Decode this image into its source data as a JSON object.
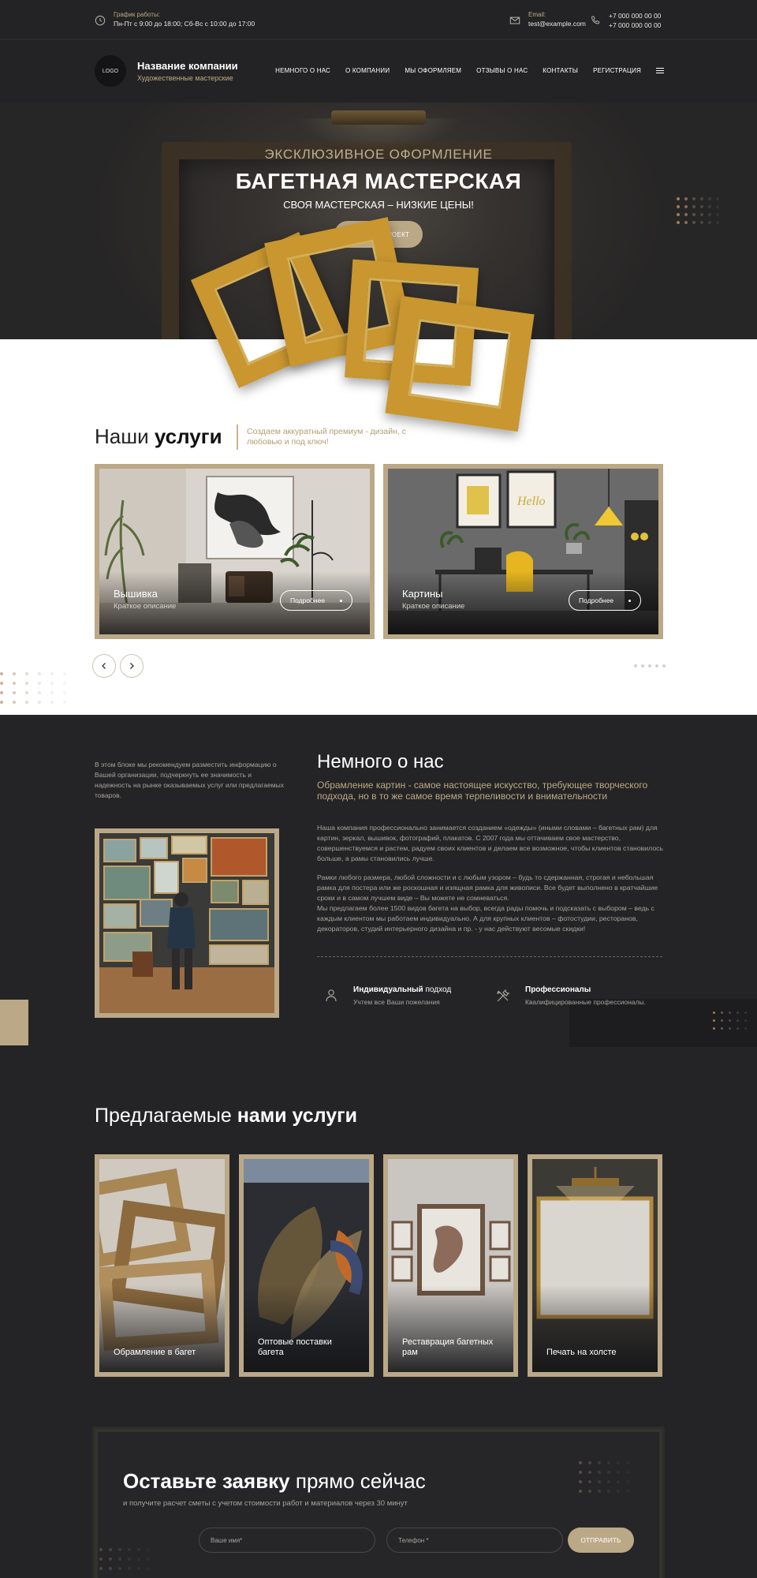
{
  "topbar": {
    "schedule_label": "График работы:",
    "schedule_value": "Пн-Пт с 9:00 до 18:00; Сб-Вс с 10:00 до 17:00",
    "email_label": "Email:",
    "email_value": "test@example.com",
    "phone_1": "+7 000 000 00 00",
    "phone_2": "+7 000 000 00 00",
    "icons": [
      "clock-icon",
      "mail-icon",
      "phone-icon"
    ]
  },
  "header": {
    "logo": "LOGO",
    "company_name": "Название компании",
    "company_tagline": "Художественные мастерские",
    "nav": [
      "НЕМНОГО О НАС",
      "О КОМПАНИИ",
      "МЫ ОФОРМЛЯЕМ",
      "ОТЗЫВЫ О НАС",
      "КОНТАКТЫ",
      "РЕГИСТРАЦИЯ"
    ],
    "menu_icon": "burger-menu-icon"
  },
  "hero": {
    "eyebrow": "ЭКСКЛЮЗИВНОЕ ОФОРМЛЕНИЕ",
    "title": "БАГЕТНАЯ МАСТЕРСКАЯ",
    "subtitle": "СВОЯ МАСТЕРСКАЯ – НИЗКИЕ ЦЕНЫ!",
    "button": "ЗАКАЗАТЬ ПРОЕКТ"
  },
  "services": {
    "heading_light": "Наши",
    "heading_bold": "услуги",
    "note": "Создаем аккуратный премиум - дизайн, с любовью и под ключ!",
    "cards": [
      {
        "title": "Вышивка",
        "desc": "Краткое описание",
        "button": "Подробнее"
      },
      {
        "title": "Картины",
        "desc": "Краткое описание",
        "button": "Подробнее"
      }
    ],
    "prev_icon": "chevron-left-icon",
    "next_icon": "chevron-right-icon",
    "pages": 5
  },
  "about": {
    "side_text": "В этом блоке мы рекомендуем разместить информацию о Вашей организации, подчеркнуть ее значимость и надежность на рынке оказываемых услуг или предлагаемых товаров.",
    "title": "Немного о нас",
    "subtitle": "Обрамление картин - самое настоящее искусство, требующее творческого подхода, но в то же самое время терпеливости и внимательности",
    "p1": "Наша компания профессионально занимается созданием «одежды» (иными словами – багетных рам) для картин, зеркал, вышивок, фотографий, плакатов. С 2007 года мы оттачиваем свое мастерство, совершенствуемся и растем, радуем своих клиентов и делаем все возможное, чтобы клиентов становилось больше, а рамы становились лучше.",
    "p2": "Рамки любого размера, любой сложности и с любым узором – будь то сдержанная, строгая и небольшая рамка для постера или же роскошная и изящная рамка для живописи. Все будет выполнено в кратчайшие сроки и в самом лучшем виде – Вы можете не сомневаться.",
    "p3": "Мы предлагаем более 1500 видов багета на выбор, всегда рады помочь и подсказать с выбором – ведь с каждым клиентом мы работаем индивидуально. А для крупных клиентов – фотостудии, ресторанов, декораторов, студий интерьерного дизайна и пр. - у нас действуют весомые скидки!",
    "features": [
      {
        "icon": "person-icon",
        "title_bold": "Индивидуальный",
        "title_rest": " подход",
        "desc": "Учтем все Ваши пожелания"
      },
      {
        "icon": "tools-icon",
        "title_bold": "Профессионалы",
        "title_rest": "",
        "desc": "Квалифицированные профессионалы."
      }
    ]
  },
  "offered": {
    "heading_light": "Предлагаемые",
    "heading_bold": "нами услуги",
    "cards": [
      "Обрамление в багет",
      "Оптовые поставки багета",
      "Реставрация багетных рам",
      "Печать на холсте"
    ]
  },
  "cta": {
    "title_bold": "Оставьте заявку",
    "title_rest": " прямо сейчас",
    "subtitle": "и получите расчет сметы с учетом стоимости работ и материалов через 30 минут",
    "name_placeholder": "Ваше имя*",
    "phone_placeholder": "Телефон *",
    "button": "ОТПРАВИТЬ"
  },
  "colors": {
    "accent": "#bba886",
    "dark_bg": "#242426",
    "gold_frame": "#c9962f"
  }
}
